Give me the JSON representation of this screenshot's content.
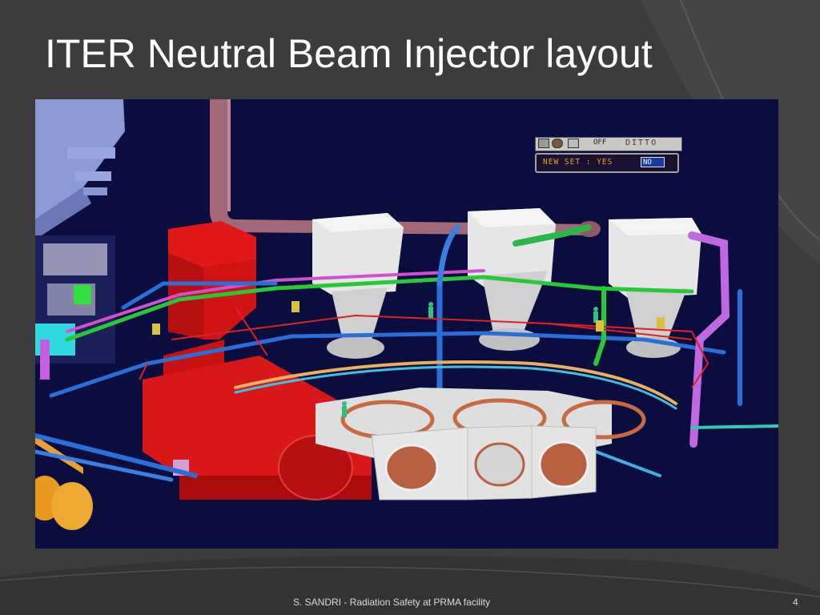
{
  "slide": {
    "title": "ITER Neutral Beam Injector layout",
    "footer": "S. SANDRI - Radiation Safety at PRMA facility",
    "page_number": "4"
  },
  "cad_toolbar": {
    "off_label": "OFF",
    "ditto_label": "DITTO",
    "new_set_label": "NEW SET : YES",
    "no_option": "NO"
  },
  "colors": {
    "slide_background": "#3b3b3b",
    "viewport_background": "#0a0d3e",
    "duct_red": "#d81818",
    "structure_white": "#e6e6e6",
    "pipe_blue": "#2a6fd8",
    "pipe_green": "#28c838",
    "pipe_purple": "#c060e0",
    "tank_orange": "#e8a030"
  }
}
